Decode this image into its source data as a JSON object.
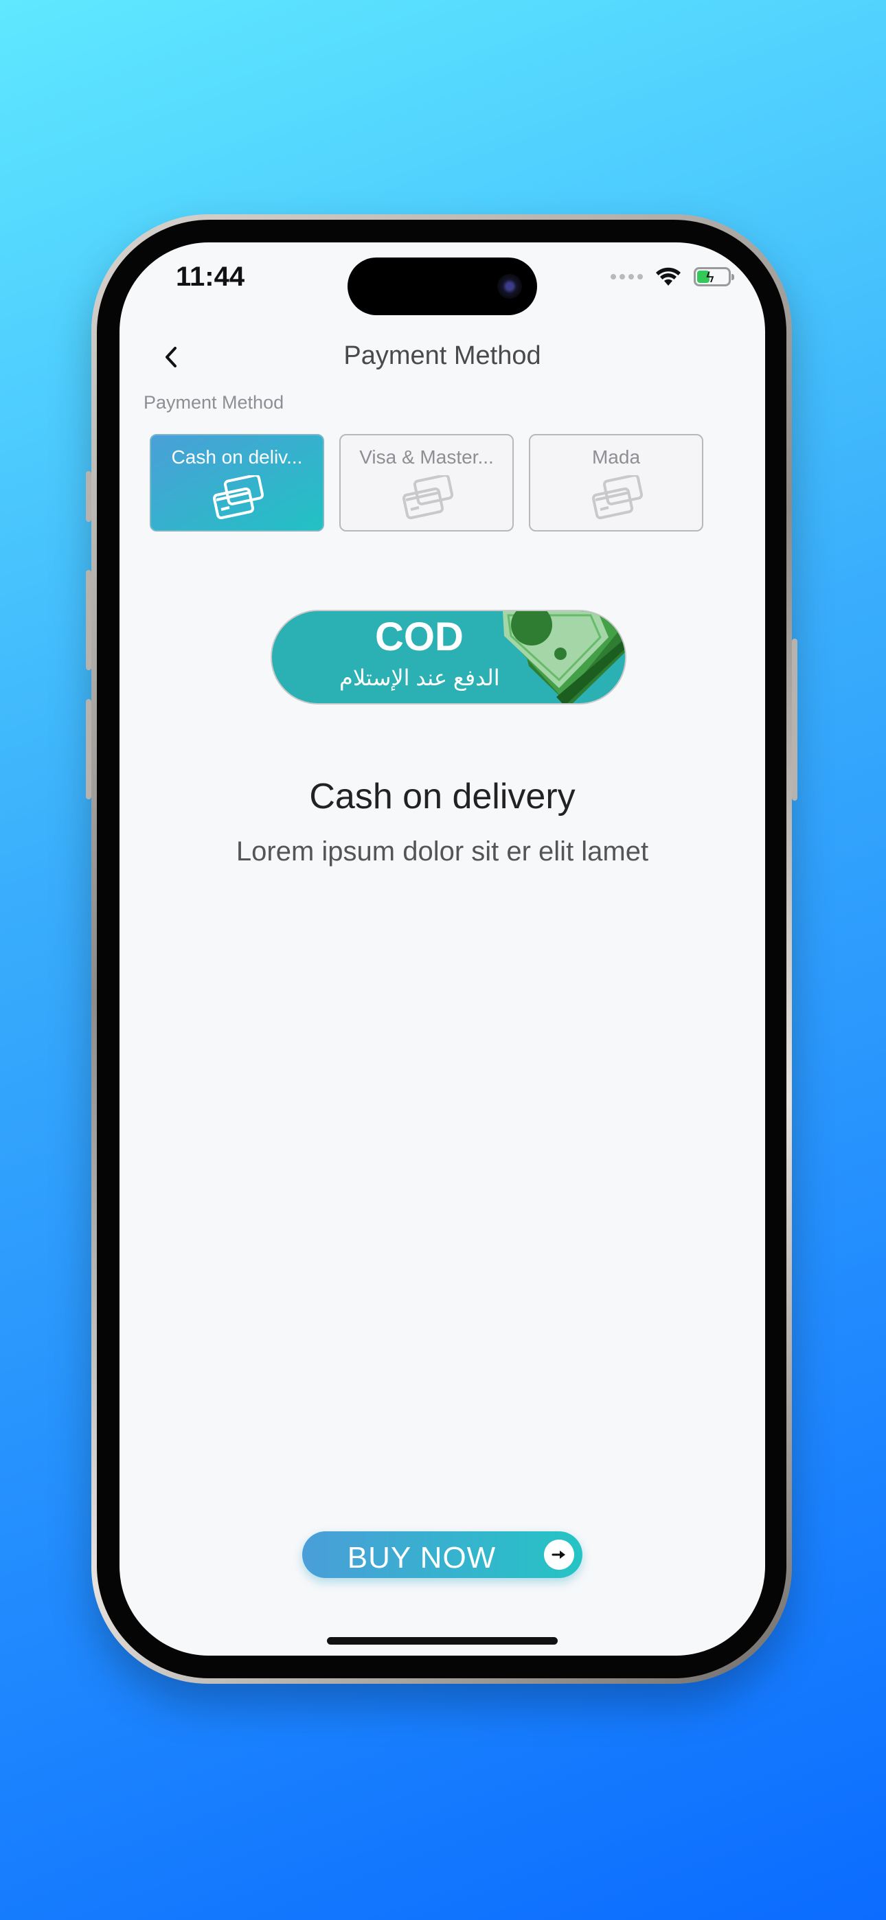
{
  "status_bar": {
    "time": "11:44"
  },
  "nav": {
    "title": "Payment Method"
  },
  "section_label": "Payment Method",
  "methods": [
    {
      "label": "Cash on deliv...",
      "selected": true
    },
    {
      "label": "Visa & Master...",
      "selected": false
    },
    {
      "label": "Mada",
      "selected": false
    }
  ],
  "banner": {
    "title": "COD",
    "subtitle": "الدفع عند الإستلام"
  },
  "selected_method": {
    "title": "Cash on delivery",
    "description": "Lorem ipsum dolor sit er elit lamet"
  },
  "buy_button": {
    "label": "BUY NOW"
  },
  "colors": {
    "accent_start": "#4a9ed9",
    "accent_end": "#22c1c3",
    "banner_teal": "#2bb0b3",
    "screen_bg": "#f7f8fa"
  }
}
